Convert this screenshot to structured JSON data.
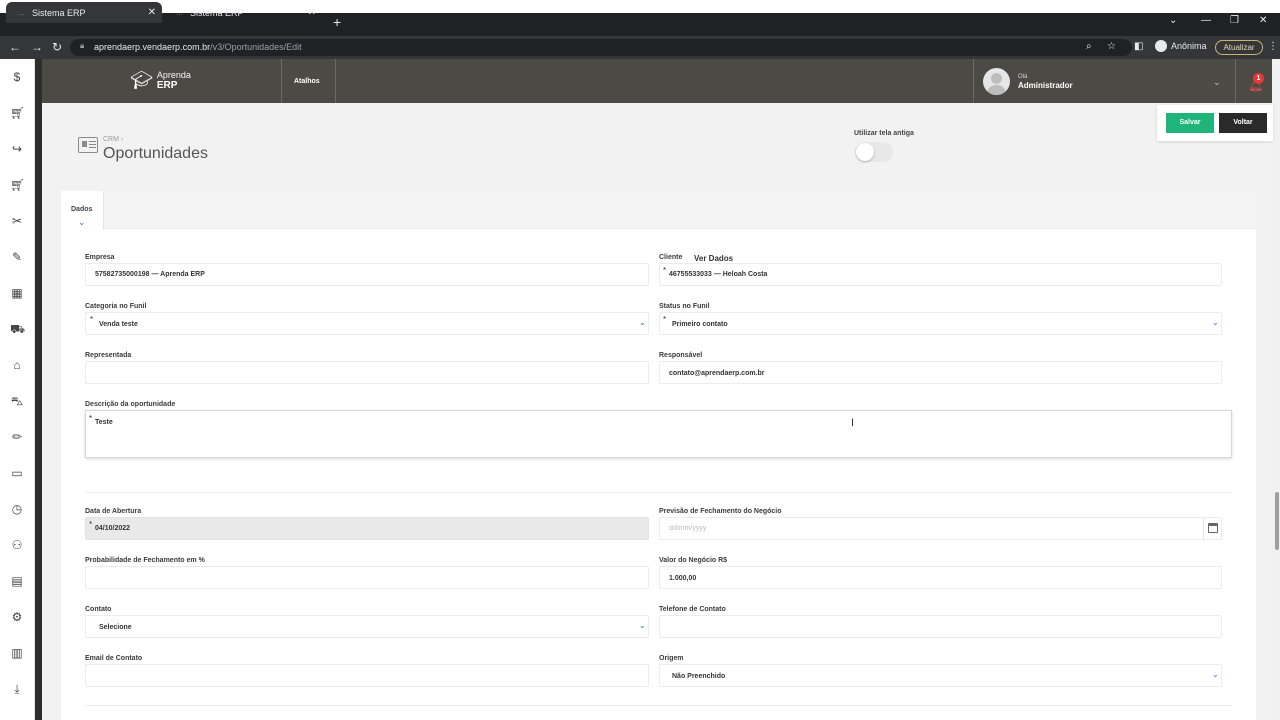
{
  "browser": {
    "tabs": [
      {
        "label": "Sistema ERP",
        "active": true
      },
      {
        "label": "Sistema ERP",
        "active": false
      }
    ],
    "url_host": "aprendaerp.vendaerp.com.br",
    "url_path": "/v3/Oportunidades/Edit",
    "profile_label": "Anônima",
    "update_label": "Atualizar"
  },
  "app": {
    "logo_line1": "Aprenda",
    "logo_line2": "ERP",
    "shortcuts_label": "Atalhos",
    "greeting": "Olá",
    "user_name": "Administrador",
    "notification_count": "1"
  },
  "page": {
    "breadcrumb": "CRM  ›",
    "title": "Oportunidades",
    "old_screen_label": "Utilizar tela antiga",
    "old_screen_enabled": false,
    "save_label": "Salvar",
    "back_label": "Voltar",
    "tab_label": "Dados"
  },
  "form": {
    "empresa": {
      "label": "Empresa",
      "value": "57582735000198 — Aprenda ERP"
    },
    "cliente": {
      "label": "Cliente",
      "link": "Ver Dados",
      "value": "46755533033 — Heloah Costa"
    },
    "categoria": {
      "label": "Categoria no Funil",
      "value": "Venda teste"
    },
    "status": {
      "label": "Status no Funil",
      "value": "Primeiro contato"
    },
    "representada": {
      "label": "Representada",
      "value": ""
    },
    "responsavel": {
      "label": "Responsável",
      "value": "contato@aprendaerp.com.br"
    },
    "descricao": {
      "label": "Descrição da oportunidade",
      "value": "Teste"
    },
    "abertura": {
      "label": "Data de Abertura",
      "value": "04/10/2022"
    },
    "previsao": {
      "label": "Previsão de Fechamento do Negócio",
      "placeholder": "dd/mm/yyyy"
    },
    "probabilidade": {
      "label": "Probabilidade de Fechamento em %",
      "value": ""
    },
    "valor": {
      "label": "Valor do Negócio R$",
      "value": "1.000,00"
    },
    "contato": {
      "label": "Contato",
      "value": "Selecione"
    },
    "telefone": {
      "label": "Telefone de Contato",
      "value": ""
    },
    "email": {
      "label": "Email de Contato",
      "value": ""
    },
    "origem": {
      "label": "Origem",
      "value": "Não Preenchido"
    }
  },
  "colors": {
    "header_bg": "#4b4a44",
    "save_button": "#1fb57a",
    "back_button": "#2a2a2a",
    "accent": "#2d73b8",
    "notification": "#e53935"
  },
  "sidebar_icons": [
    "dollar-icon",
    "cart-icon",
    "share-icon",
    "cart-icon",
    "tools-icon",
    "edit-icon",
    "boxes-icon",
    "truck-icon",
    "building-icon",
    "car-icon",
    "pen-icon",
    "monitor-icon",
    "clock-icon",
    "users-icon",
    "document-icon",
    "settings-icon",
    "chart-icon",
    "download-icon"
  ]
}
